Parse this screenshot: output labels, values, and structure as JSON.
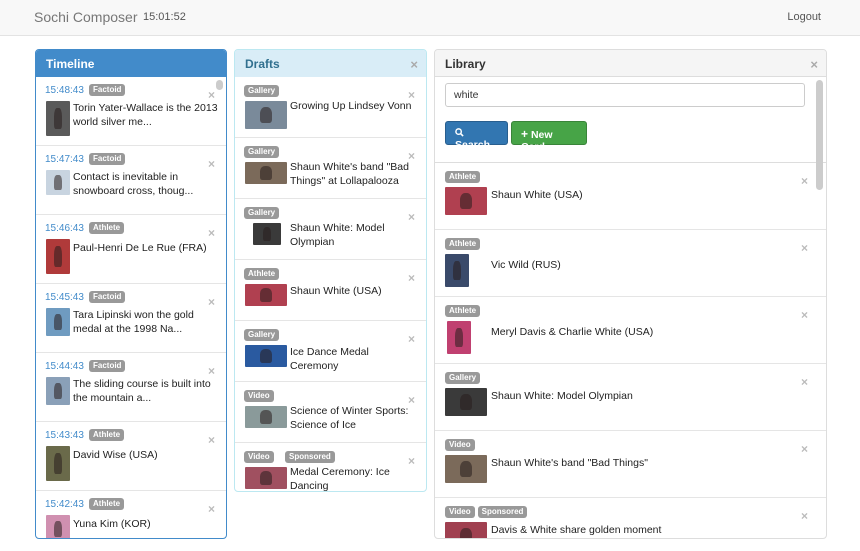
{
  "app": {
    "title": "Sochi Composer",
    "clock": "15:01:52",
    "logout_label": "Logout"
  },
  "timeline": {
    "title": "Timeline",
    "items": [
      {
        "time": "15:48:43",
        "type": "Factoid",
        "text": "Torin Yater-Wallace is the 2013 world silver me...",
        "thumb": "#5a5a5a"
      },
      {
        "time": "15:47:43",
        "type": "Factoid",
        "text": "Contact is inevitable in snowboard cross, thoug...",
        "thumb": "#c8d4e0"
      },
      {
        "time": "15:46:43",
        "type": "Athlete",
        "text": "Paul-Henri De Le Rue (FRA)",
        "thumb": "#b03a3a"
      },
      {
        "time": "15:45:43",
        "type": "Factoid",
        "text": "Tara Lipinski won the gold medal at the 1998 Na...",
        "thumb": "#6f9bc0"
      },
      {
        "time": "15:44:43",
        "type": "Factoid",
        "text": "The sliding course is built into the mountain a...",
        "thumb": "#8aa0b8"
      },
      {
        "time": "15:43:43",
        "type": "Athlete",
        "text": "David Wise (USA)",
        "thumb": "#6a6a4a"
      },
      {
        "time": "15:42:43",
        "type": "Athlete",
        "text": "Yuna Kim (KOR)",
        "thumb": "#d090b0"
      }
    ]
  },
  "drafts": {
    "title": "Drafts",
    "items": [
      {
        "type": "Gallery",
        "extra": "",
        "text": "Growing Up Lindsey Vonn",
        "thumb": "#7a8a9a"
      },
      {
        "type": "Gallery",
        "extra": "",
        "text": "Shaun White's band \"Bad Things\" at Lollapalooza",
        "thumb": "#7b6a5a"
      },
      {
        "type": "Gallery",
        "extra": "",
        "text": "Shaun White: Model Olympian",
        "thumb": "#3a3a3a"
      },
      {
        "type": "Athlete",
        "extra": "",
        "text": "Shaun White (USA)",
        "thumb": "#b04050"
      },
      {
        "type": "Gallery",
        "extra": "",
        "text": "Ice Dance Medal Ceremony",
        "thumb": "#2a5aa0"
      },
      {
        "type": "Video",
        "extra": "",
        "text": "Science of Winter Sports: Science of Ice",
        "thumb": "#8a9a9a"
      },
      {
        "type": "Video",
        "extra": "Sponsored",
        "text": "Medal Ceremony: Ice Dancing",
        "thumb": "#a05060"
      }
    ]
  },
  "library": {
    "title": "Library",
    "search_value": "white",
    "search_label": "Search",
    "new_card_label": "New Card",
    "items": [
      {
        "type": "Athlete",
        "extra": "",
        "text": "Shaun White (USA)",
        "thumb": "#b04050"
      },
      {
        "type": "Athlete",
        "extra": "",
        "text": "Vic Wild (RUS)",
        "thumb": "#3a4a6a"
      },
      {
        "type": "Athlete",
        "extra": "",
        "text": "Meryl Davis & Charlie White (USA)",
        "thumb": "#c04070"
      },
      {
        "type": "Gallery",
        "extra": "",
        "text": "Shaun White: Model Olympian",
        "thumb": "#3a3a3a"
      },
      {
        "type": "Video",
        "extra": "",
        "text": "Shaun White's band \"Bad Things\"",
        "thumb": "#7b6a5a"
      },
      {
        "type": "Video",
        "extra": "Sponsored",
        "text": "Davis & White share golden moment",
        "thumb": "#a04050"
      }
    ]
  },
  "colors": {
    "primary": "#428bca",
    "info_bg": "#d9edf7",
    "success": "#47a447",
    "badge": "#999999"
  },
  "icons": {
    "close": "close-icon",
    "search": "search-icon",
    "plus": "plus-icon"
  }
}
